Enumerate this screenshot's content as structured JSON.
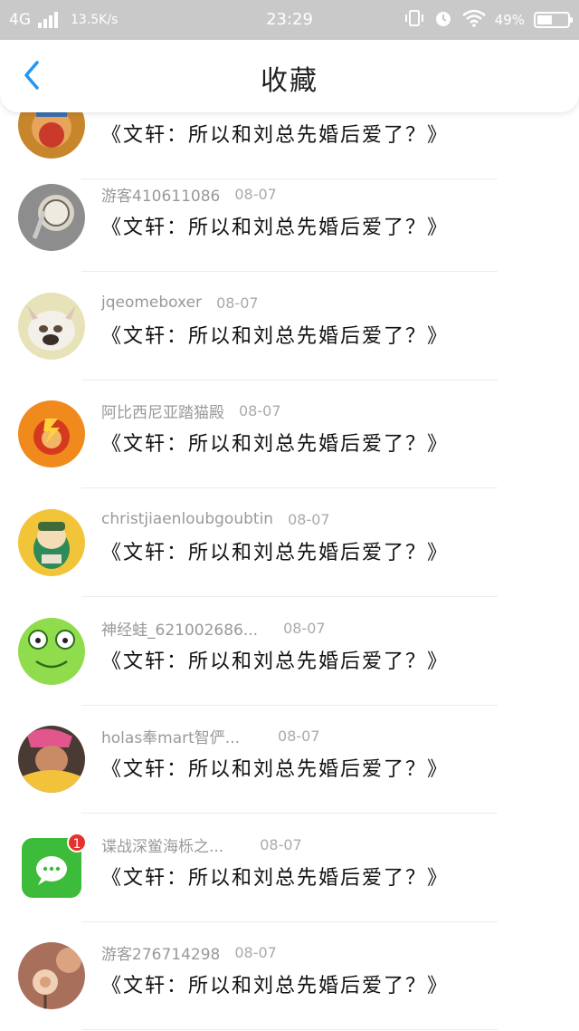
{
  "status_bar": {
    "network": "4G",
    "speed": "13.5K/s",
    "time": "23:29",
    "battery": "49%",
    "battery_level": 0.49
  },
  "nav": {
    "title": "收藏",
    "back_icon": "chevron-left-icon",
    "accent": "#2196f3"
  },
  "items": [
    {
      "user": "",
      "date": "",
      "title": "《文轩：所以和刘总先婚后爱了？》",
      "avatar": "cartoon-avatar"
    },
    {
      "user": "游客410611086",
      "date": "08-07",
      "title": "《文轩：所以和刘总先婚后爱了？》",
      "avatar": "pocket-watch-avatar"
    },
    {
      "user": "jqeomeboxer",
      "date": "08-07",
      "title": "《文轩：所以和刘总先婚后爱了？》",
      "avatar": "bulldog-avatar"
    },
    {
      "user": "阿比西尼亚踏猫殿",
      "date": "08-07",
      "title": "《文轩：所以和刘总先婚后爱了？》",
      "avatar": "flash-hero-avatar"
    },
    {
      "user": "christjiaenloubgoubtin",
      "date": "08-07",
      "title": "《文轩：所以和刘总先婚后爱了？》",
      "avatar": "cartoon-character-avatar"
    },
    {
      "user": "神经蛙_621002686...",
      "date": "08-07",
      "title": "《文轩：所以和刘总先婚后爱了？》",
      "avatar": "frog-avatar"
    },
    {
      "user": "holas奉mart智俨...",
      "date": "08-07",
      "title": "《文轩：所以和刘总先婚后爱了？》",
      "avatar": "person-photo-avatar"
    },
    {
      "user": "谍战深鲎海栎之...",
      "date": "08-07",
      "title": "《文轩：所以和刘总先婚后爱了？》",
      "avatar": "chat-app-avatar",
      "badge": "1"
    },
    {
      "user": "游客276714298",
      "date": "08-07",
      "title": "《文轩：所以和刘总先婚后爱了？》",
      "avatar": "flower-photo-avatar"
    }
  ]
}
